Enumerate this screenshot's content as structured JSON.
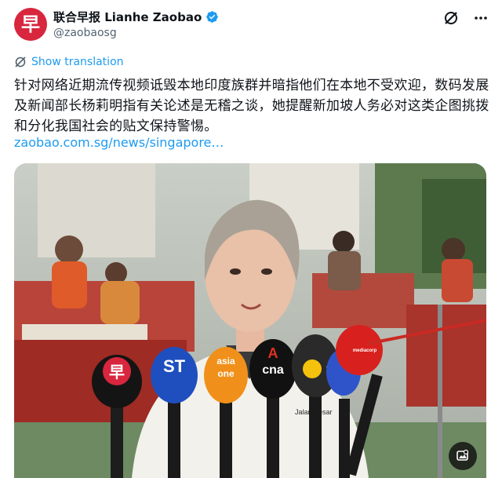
{
  "account": {
    "display_name": "联合早报 Lianhe Zaobao",
    "handle": "@zaobaosg",
    "avatar_glyph": "早",
    "brand_color": "#d7263d"
  },
  "header_icons": [
    "grok-icon",
    "more-icon"
  ],
  "translation": {
    "label": "Show translation",
    "icon": "translate-icon"
  },
  "tweet": {
    "text": "针对网络近期流传视频诋毁本地印度族群并暗指他们在本地不受欢迎，数码发展及新闻部长杨莉明指有关论述是无稽之谈，她提醒新加坡人务必对这类企图挑拨和分化我国社会的贴文保持警惕。",
    "link": "zaobao.com.sg/news/singapore…"
  },
  "media": {
    "microphones": {
      "zaobao": "早",
      "st": "ST",
      "asia_one_top": "asia",
      "asia_one_bottom": "one",
      "cna": "cna",
      "cna_letter": "A",
      "mediacorp_8": "8",
      "mediacorp_top": "mediacorp"
    },
    "shirt_text": "Jalan Besar",
    "button_icon": "image-edit-icon",
    "link_color": "#1d9bf0"
  }
}
